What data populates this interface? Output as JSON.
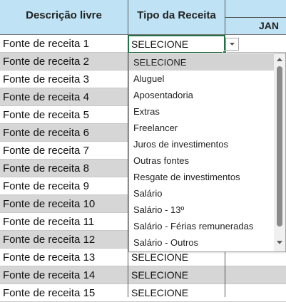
{
  "header": {
    "col_a": "Descrição livre",
    "col_b": "Tipo da Receita",
    "col_c": "JAN"
  },
  "rows": [
    {
      "label": "Fonte de receita 1",
      "value": "SELECIONE"
    },
    {
      "label": "Fonte de receita 2",
      "value": ""
    },
    {
      "label": "Fonte de receita 3",
      "value": ""
    },
    {
      "label": "Fonte de receita 4",
      "value": ""
    },
    {
      "label": "Fonte de receita 5",
      "value": ""
    },
    {
      "label": "Fonte de receita 6",
      "value": ""
    },
    {
      "label": "Fonte de receita 7",
      "value": ""
    },
    {
      "label": "Fonte de receita 8",
      "value": ""
    },
    {
      "label": "Fonte de receita 9",
      "value": ""
    },
    {
      "label": "Fonte de receita 10",
      "value": ""
    },
    {
      "label": "Fonte de receita 11",
      "value": ""
    },
    {
      "label": "Fonte de receita 12",
      "value": ""
    },
    {
      "label": "Fonte de receita 13",
      "value": "SELECIONE"
    },
    {
      "label": "Fonte de receita 14",
      "value": "SELECIONE"
    },
    {
      "label": "Fonte de receita 15",
      "value": "SELECIONE"
    }
  ],
  "dropdown": {
    "selected": "SELECIONE",
    "options": [
      "SELECIONE",
      "Aluguel",
      "Aposentadoria",
      "Extras",
      "Freelancer",
      "Juros de investimentos",
      "Outras fontes",
      "Resgate de investimentos",
      "Salário",
      "Salário - 13º",
      "Salário - Férias remuneradas",
      "Salário - Outros"
    ]
  },
  "icons": {
    "dropdown_toggle": "chevron-down-icon",
    "scroll_up": "triangle-up-icon",
    "scroll_down": "triangle-down-icon"
  },
  "colors": {
    "header_bg": "#bfe3f5",
    "band_gray": "#d6d6d6",
    "active_cell_border": "#217346"
  }
}
